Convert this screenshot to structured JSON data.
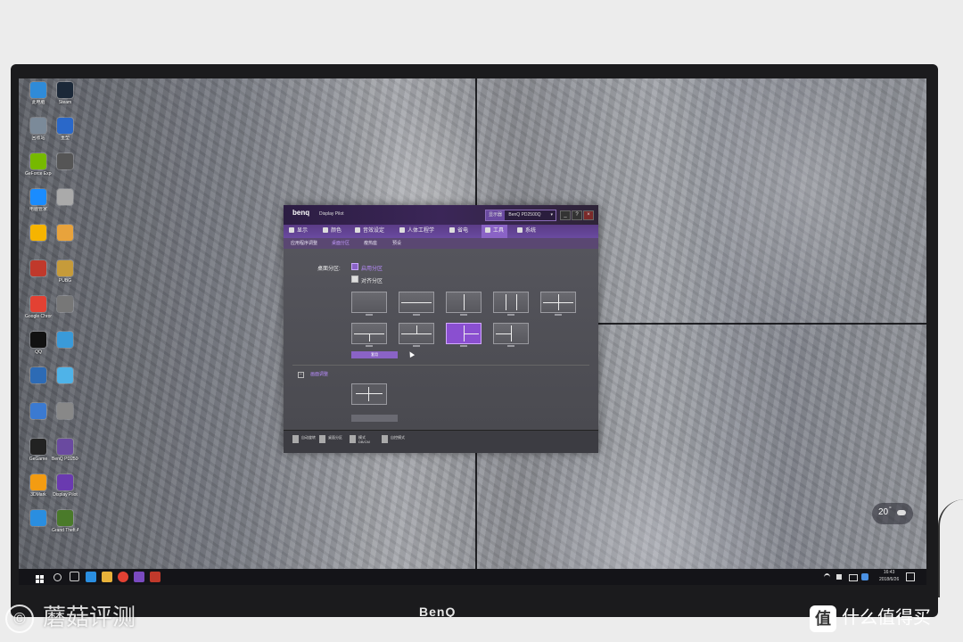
{
  "monitor": {
    "brand": "BenQ"
  },
  "desktop_icons": [
    {
      "label": "此电脑",
      "color": "#2f8bd8"
    },
    {
      "label": "Steam",
      "color": "#1b2838"
    },
    {
      "label": "回收站",
      "color": "#7b8a99"
    },
    {
      "label": "重塑",
      "color": "#2a68c9"
    },
    {
      "label": "GeForce Experience",
      "color": "#76b900"
    },
    {
      "label": "",
      "color": "#555"
    },
    {
      "label": "电脑管家",
      "color": "#1a8cff"
    },
    {
      "label": "",
      "color": "#aaa"
    },
    {
      "label": "",
      "color": "#f6b400"
    },
    {
      "label": "",
      "color": "#e8a33c"
    },
    {
      "label": "",
      "color": "#c0392b"
    },
    {
      "label": "PUBG",
      "color": "#c69b3a"
    },
    {
      "label": "Google Chrome",
      "color": "#e34133"
    },
    {
      "label": "",
      "color": "#777"
    },
    {
      "label": "QQ",
      "color": "#111"
    },
    {
      "label": "",
      "color": "#3a9ad9"
    },
    {
      "label": "",
      "color": "#2d6bb5"
    },
    {
      "label": "",
      "color": "#4fb3e8"
    },
    {
      "label": "",
      "color": "#3b7ad1"
    },
    {
      "label": "",
      "color": "#888"
    },
    {
      "label": "GeGame",
      "color": "#222"
    },
    {
      "label": "BenQ PD2500Q",
      "color": "#6a4aa0"
    },
    {
      "label": "3DMark",
      "color": "#f39c12"
    },
    {
      "label": "Display Pilot",
      "color": "#6a3ab0"
    },
    {
      "label": "",
      "color": "#2a8ee0"
    },
    {
      "label": "Grand Theft Auto V",
      "color": "#4a7a2a"
    }
  ],
  "taskbar": {
    "time": "16:43",
    "date": "2018/6/26"
  },
  "weather": {
    "temp": "20",
    "unit": "°"
  },
  "window": {
    "brand": "benq",
    "app_title": "Display Pilot",
    "monitor_select": "BenQ PD2500Q",
    "buttons": {
      "minimize": "_",
      "help": "?",
      "close": "×",
      "monitor_label": "显示器"
    },
    "tabs": [
      {
        "label": "显示",
        "active": false
      },
      {
        "label": "颜色",
        "active": false
      },
      {
        "label": "音效设定",
        "active": false
      },
      {
        "label": "人体工程学",
        "active": false
      },
      {
        "label": "省电",
        "active": false
      },
      {
        "label": "工具",
        "active": true
      },
      {
        "label": "系统",
        "active": false
      }
    ],
    "subtabs": [
      {
        "label": "应用程序调整",
        "active": false
      },
      {
        "label": "桌面分区",
        "active": true
      },
      {
        "label": "瘦热座",
        "active": false
      },
      {
        "label": "预设",
        "active": false
      }
    ],
    "partition_label": "桌面分区:",
    "enable_label": "启用分区",
    "enable_checked": true,
    "each_label": "对齐分区",
    "each_checked": false,
    "apply_label": "套用",
    "selected_layout_index": 7,
    "section_label": "画面调整",
    "bottom_items": [
      {
        "label": "自动旋转"
      },
      {
        "label": "桌面分区"
      },
      {
        "label": "模式 DB/CM"
      },
      {
        "label": "自控模式"
      }
    ]
  },
  "watermark": {
    "left_symbol": "©",
    "left_text": "蘑菇评测",
    "right_badge": "值",
    "right_text": "什么值得买"
  }
}
